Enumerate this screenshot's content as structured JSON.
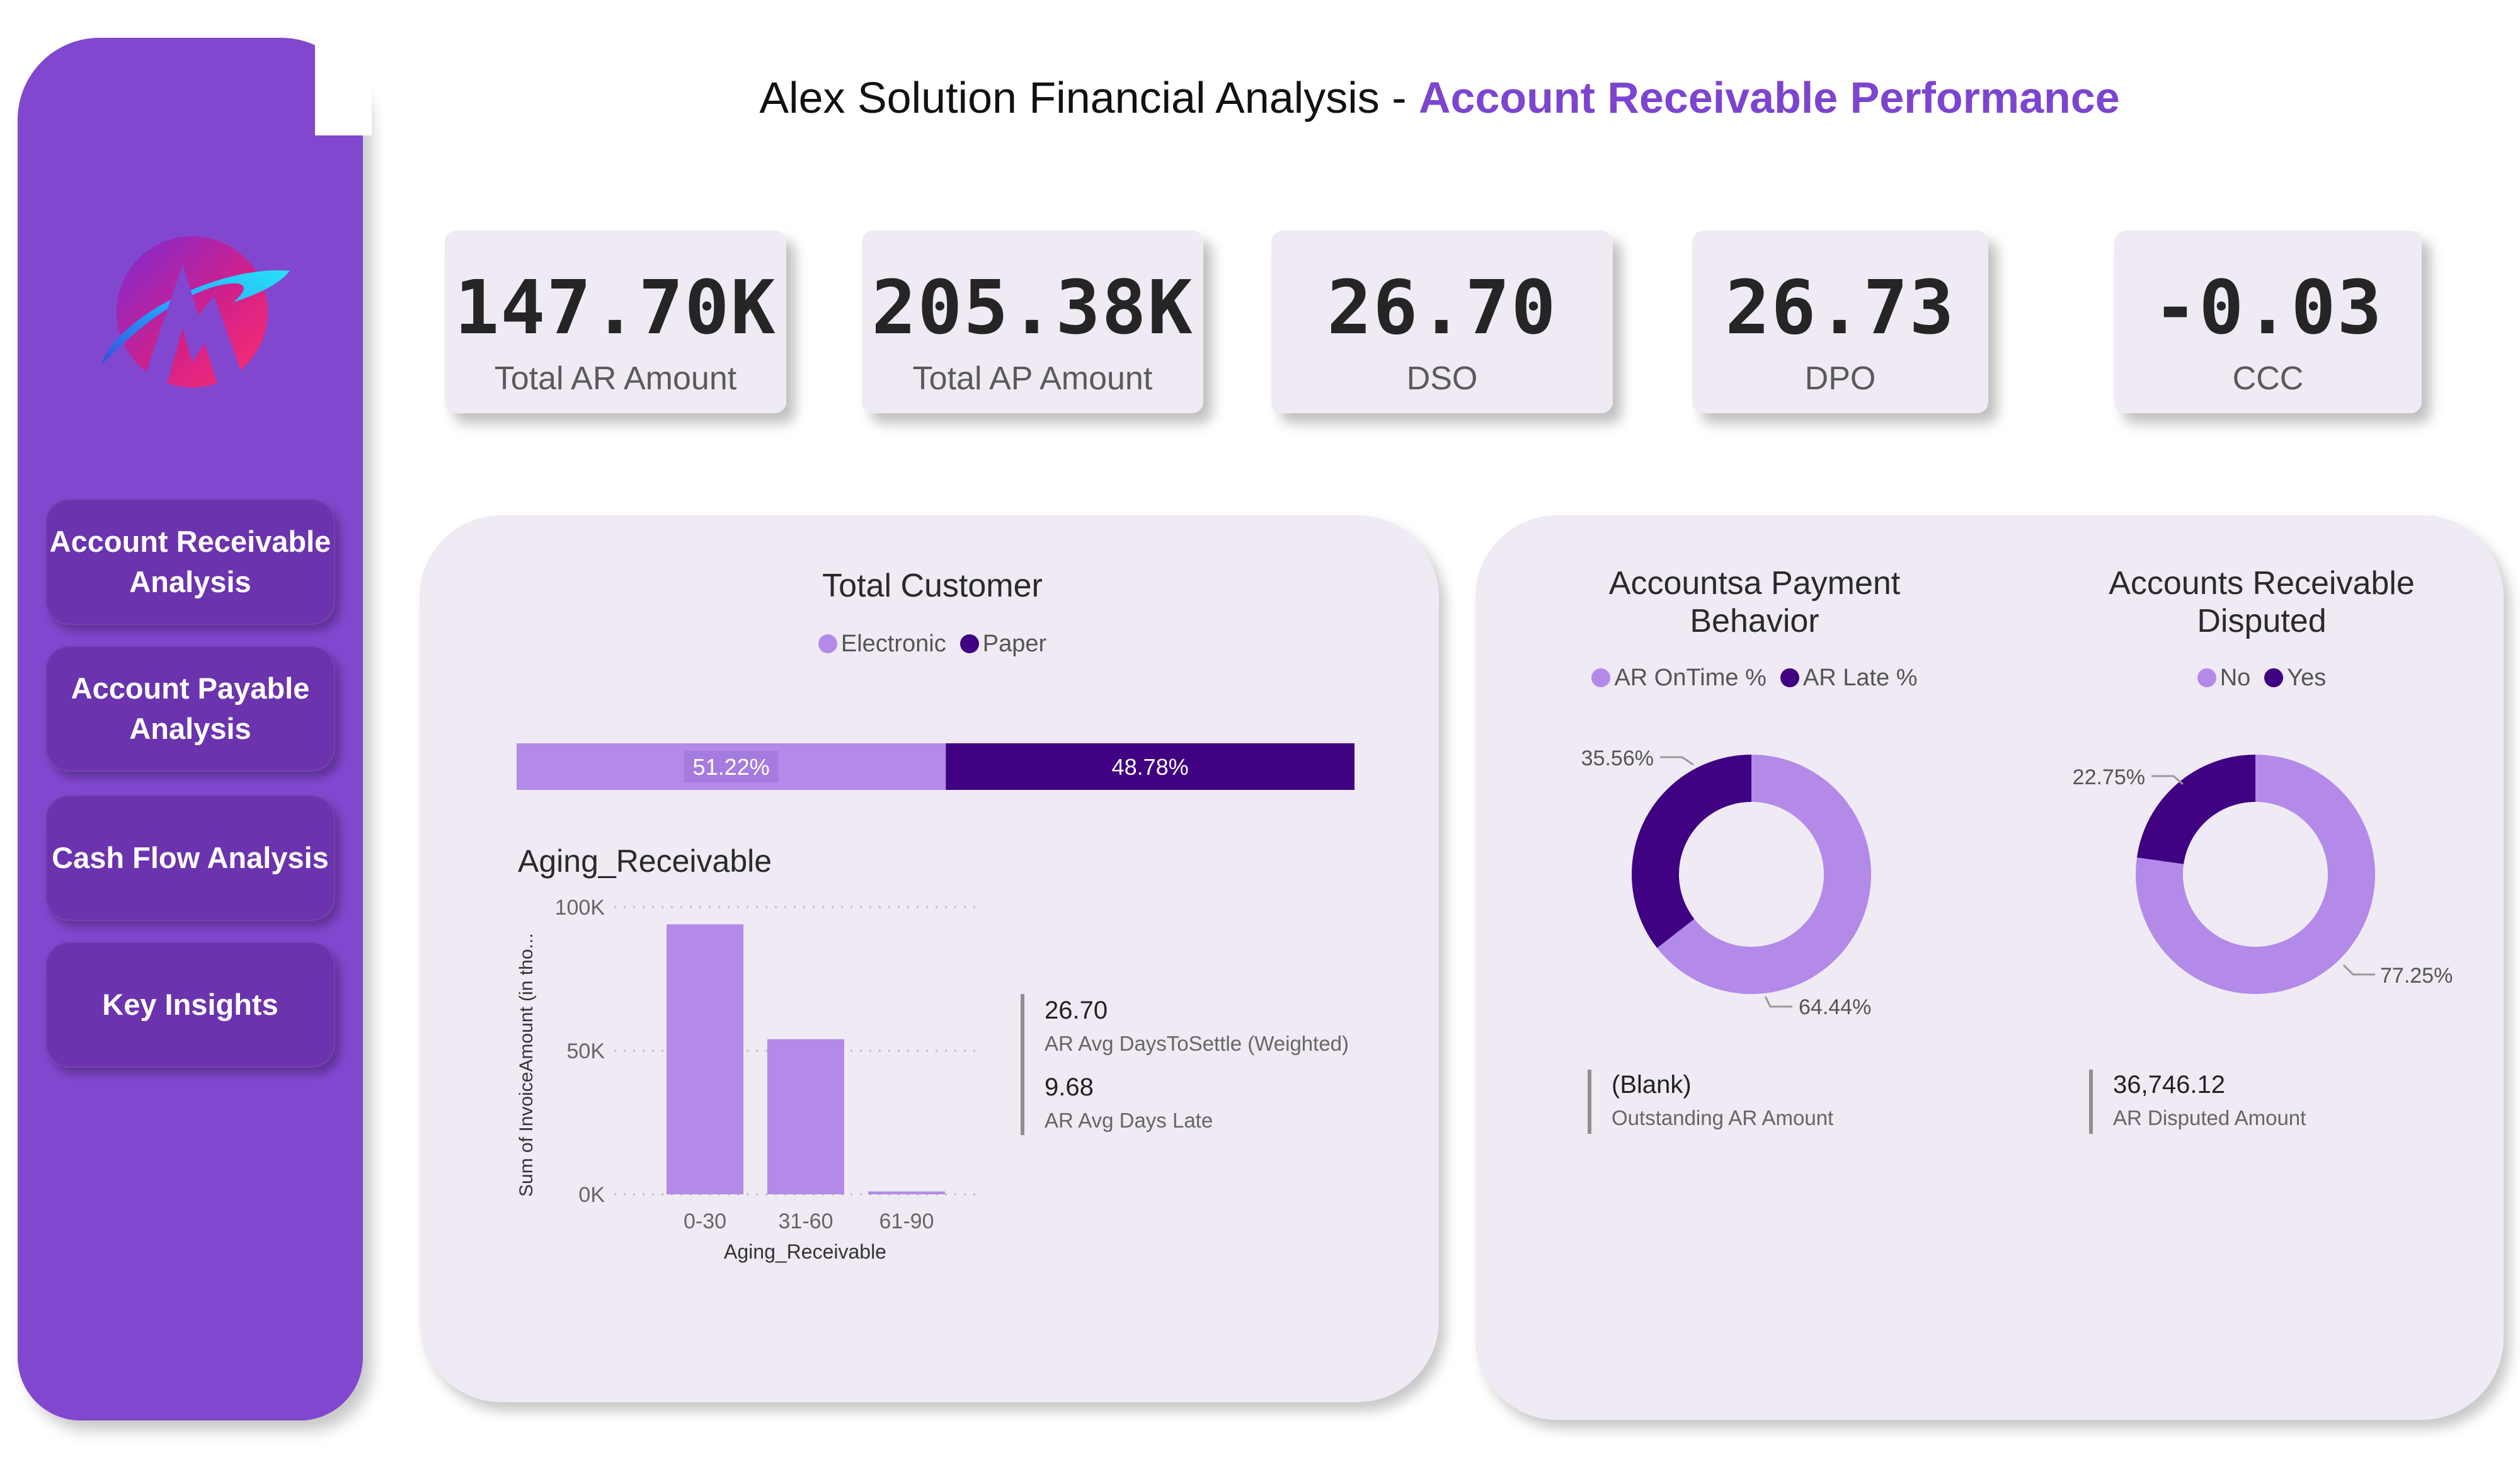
{
  "colors": {
    "primary": "#8247cf",
    "nav_button": "#6b33ad",
    "light_series": "#b38ae8",
    "dark_series": "#3f0082",
    "panel_bg": "#efeaf4",
    "accent_title": "#7c45cf"
  },
  "header": {
    "title_prefix": "Alex Solution Financial Analysis - ",
    "title_accent": "Account Receivable Performance"
  },
  "sidebar": {
    "logo_icon": "company-logo-icon",
    "items": [
      {
        "label": "Account Receivable\nAnalysis"
      },
      {
        "label": "Account Payable\nAnalysis"
      },
      {
        "label": "Cash Flow Analysis"
      },
      {
        "label": "Key Insights"
      }
    ]
  },
  "kpis": [
    {
      "value": "147.70K",
      "label": "Total AR Amount"
    },
    {
      "value": "205.38K",
      "label": "Total AP Amount"
    },
    {
      "value": "26.70",
      "label": "DSO"
    },
    {
      "value": "26.73",
      "label": "DPO"
    },
    {
      "value": "-0.03",
      "label": "CCC"
    }
  ],
  "total_customer": {
    "title": "Total Customer",
    "legend": [
      "Electronic",
      "Paper"
    ],
    "labels": [
      "51.22%",
      "48.78%"
    ]
  },
  "aging": {
    "title": "Aging_Receivable",
    "xlabel": "Aging_Receivable",
    "ylabel": "Sum of InvoiceAmount (in tho...",
    "yticks": [
      "100K",
      "50K",
      "0K"
    ]
  },
  "ar_metrics": [
    {
      "value": "26.70",
      "label": "AR Avg DaysToSettle (Weighted)"
    },
    {
      "value": "9.68",
      "label": "AR Avg Days Late"
    }
  ],
  "payment_behavior": {
    "title": "Accountsa Payment\nBehavior",
    "legend": [
      "AR OnTime %",
      "AR Late %"
    ],
    "labels": [
      "64.44%",
      "35.56%"
    ]
  },
  "disputed": {
    "title": "Accounts Receivable\nDisputed",
    "legend": [
      "No",
      "Yes"
    ],
    "labels": [
      "77.25%",
      "22.75%"
    ]
  },
  "outstanding": {
    "value": "(Blank)",
    "label": "Outstanding AR Amount"
  },
  "disputed_amount": {
    "value": "36,746.12",
    "label": "AR Disputed Amount"
  },
  "chart_data": [
    {
      "type": "bar",
      "title": "Total Customer",
      "orientation": "horizontal-100%-stacked",
      "categories": [
        "Total Customer"
      ],
      "series": [
        {
          "name": "Electronic",
          "values": [
            51.22
          ]
        },
        {
          "name": "Paper",
          "values": [
            48.78
          ]
        }
      ]
    },
    {
      "type": "bar",
      "title": "Aging_Receivable",
      "categories": [
        "0-30",
        "31-60",
        "61-90"
      ],
      "values": [
        94000,
        54000,
        1000
      ],
      "xlabel": "Aging_Receivable",
      "ylabel": "Sum of InvoiceAmount (in tho...",
      "ylim": [
        0,
        100000
      ],
      "grid": true
    },
    {
      "type": "pie",
      "title": "Accountsa Payment Behavior",
      "categories": [
        "AR OnTime %",
        "AR Late %"
      ],
      "values": [
        64.44,
        35.56
      ]
    },
    {
      "type": "pie",
      "title": "Accounts Receivable Disputed",
      "categories": [
        "No",
        "Yes"
      ],
      "values": [
        77.25,
        22.75
      ]
    }
  ]
}
